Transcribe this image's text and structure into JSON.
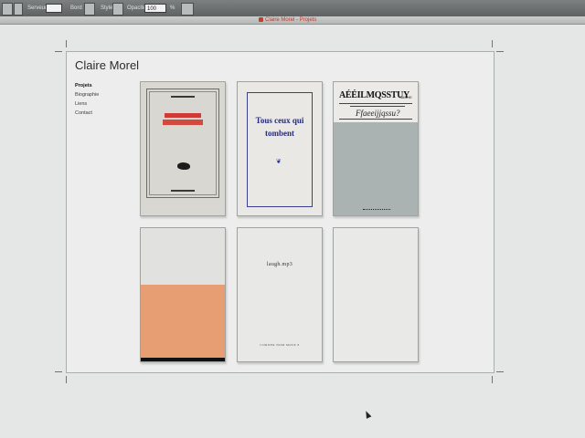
{
  "toolbar": {
    "field1_label": "Serveur",
    "field2_label": "Bord",
    "field3_label": "Style",
    "field4_label": "Opacité",
    "field4_value": "100",
    "field5_label": "%"
  },
  "document": {
    "title": "Claire Morel - Projets"
  },
  "site": {
    "title": "Claire Morel",
    "nav": [
      "Projets",
      "Biographie",
      "Liens",
      "Contact"
    ]
  },
  "cards": {
    "card2_title": "Tous ceux qui tombent",
    "card3_heading": "AÉÉILMQSSTUY",
    "card3_sub": "SACHE",
    "card3_script": "Ffaeeijjqssu?",
    "card5_title": "laugh.mp3",
    "card5_footer": "CORNER NOM MOSE 8"
  },
  "colors": {
    "accent_red": "#cf3b34",
    "card4_orange": "#e79e72",
    "card3_grey": "#aab3b1",
    "card2_blue": "#262a7a"
  }
}
